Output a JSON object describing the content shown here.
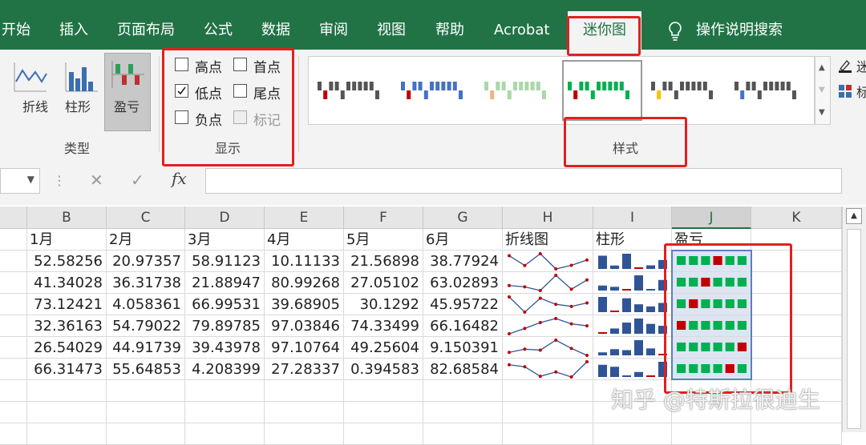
{
  "ribbon_tabs": [
    "开始",
    "插入",
    "页面布局",
    "公式",
    "数据",
    "审阅",
    "视图",
    "帮助",
    "Acrobat",
    "迷你图"
  ],
  "tell_me": "操作说明搜索",
  "type_group": {
    "label": "类型",
    "line": "折线",
    "column": "柱形",
    "winloss": "盈亏"
  },
  "show_group": {
    "label": "显示",
    "options": [
      {
        "label": "高点",
        "checked": false,
        "disabled": false
      },
      {
        "label": "首点",
        "checked": false,
        "disabled": false
      },
      {
        "label": "低点",
        "checked": true,
        "disabled": false
      },
      {
        "label": "尾点",
        "checked": false,
        "disabled": false
      },
      {
        "label": "负点",
        "checked": false,
        "disabled": false
      },
      {
        "label": "标记",
        "checked": false,
        "disabled": true
      }
    ]
  },
  "style_group": {
    "label": "样式"
  },
  "right_partial": {
    "a": "迷",
    "b": "标"
  },
  "formula_bar": {
    "cancel": "✕",
    "enter": "✓",
    "fx": "fx",
    "value": ""
  },
  "columns": [
    "B",
    "C",
    "D",
    "E",
    "F",
    "G",
    "H",
    "I",
    "J",
    "K"
  ],
  "header_row": [
    "1月",
    "2月",
    "3月",
    "4月",
    "5月",
    "6月",
    "折线图",
    "柱形",
    "盈亏"
  ],
  "rows": [
    [
      "52.58256",
      "20.97357",
      "58.91123",
      "10.11133",
      "21.56898",
      "38.77924"
    ],
    [
      "41.34028",
      "36.31738",
      "21.88947",
      "80.99268",
      "27.05102",
      "63.02893"
    ],
    [
      "73.12421",
      "4.058361",
      "66.99531",
      "39.68905",
      "30.1292",
      "45.95722"
    ],
    [
      "32.36163",
      "54.79022",
      "79.89785",
      "97.03846",
      "74.33499",
      "66.16482"
    ],
    [
      "26.54029",
      "44.91739",
      "39.43978",
      "97.10764",
      "49.25604",
      "9.150391"
    ],
    [
      "66.31473",
      "55.64853",
      "4.208399",
      "27.28337",
      "0.394583",
      "82.68584"
    ]
  ],
  "sparkline_values": [
    [
      52.58256,
      20.97357,
      58.91123,
      10.11133,
      21.56898,
      38.77924
    ],
    [
      41.34028,
      36.31738,
      21.88947,
      80.99268,
      27.05102,
      63.02893
    ],
    [
      73.12421,
      4.058361,
      66.99531,
      39.68905,
      30.1292,
      45.95722
    ],
    [
      32.36163,
      54.79022,
      79.89785,
      97.03846,
      74.33499,
      66.16482
    ],
    [
      26.54029,
      44.91739,
      39.43978,
      97.10764,
      49.25604,
      9.150391
    ],
    [
      66.31473,
      55.64853,
      4.208399,
      27.28337,
      0.394583,
      82.68584
    ]
  ],
  "colors": {
    "excel_green": "#217346",
    "bar": "#2f5597",
    "low": "#c00000",
    "win": "#00b050",
    "marker": "#c00000",
    "line": "#2f5597"
  },
  "watermark": "知乎 @特斯拉很迪生"
}
